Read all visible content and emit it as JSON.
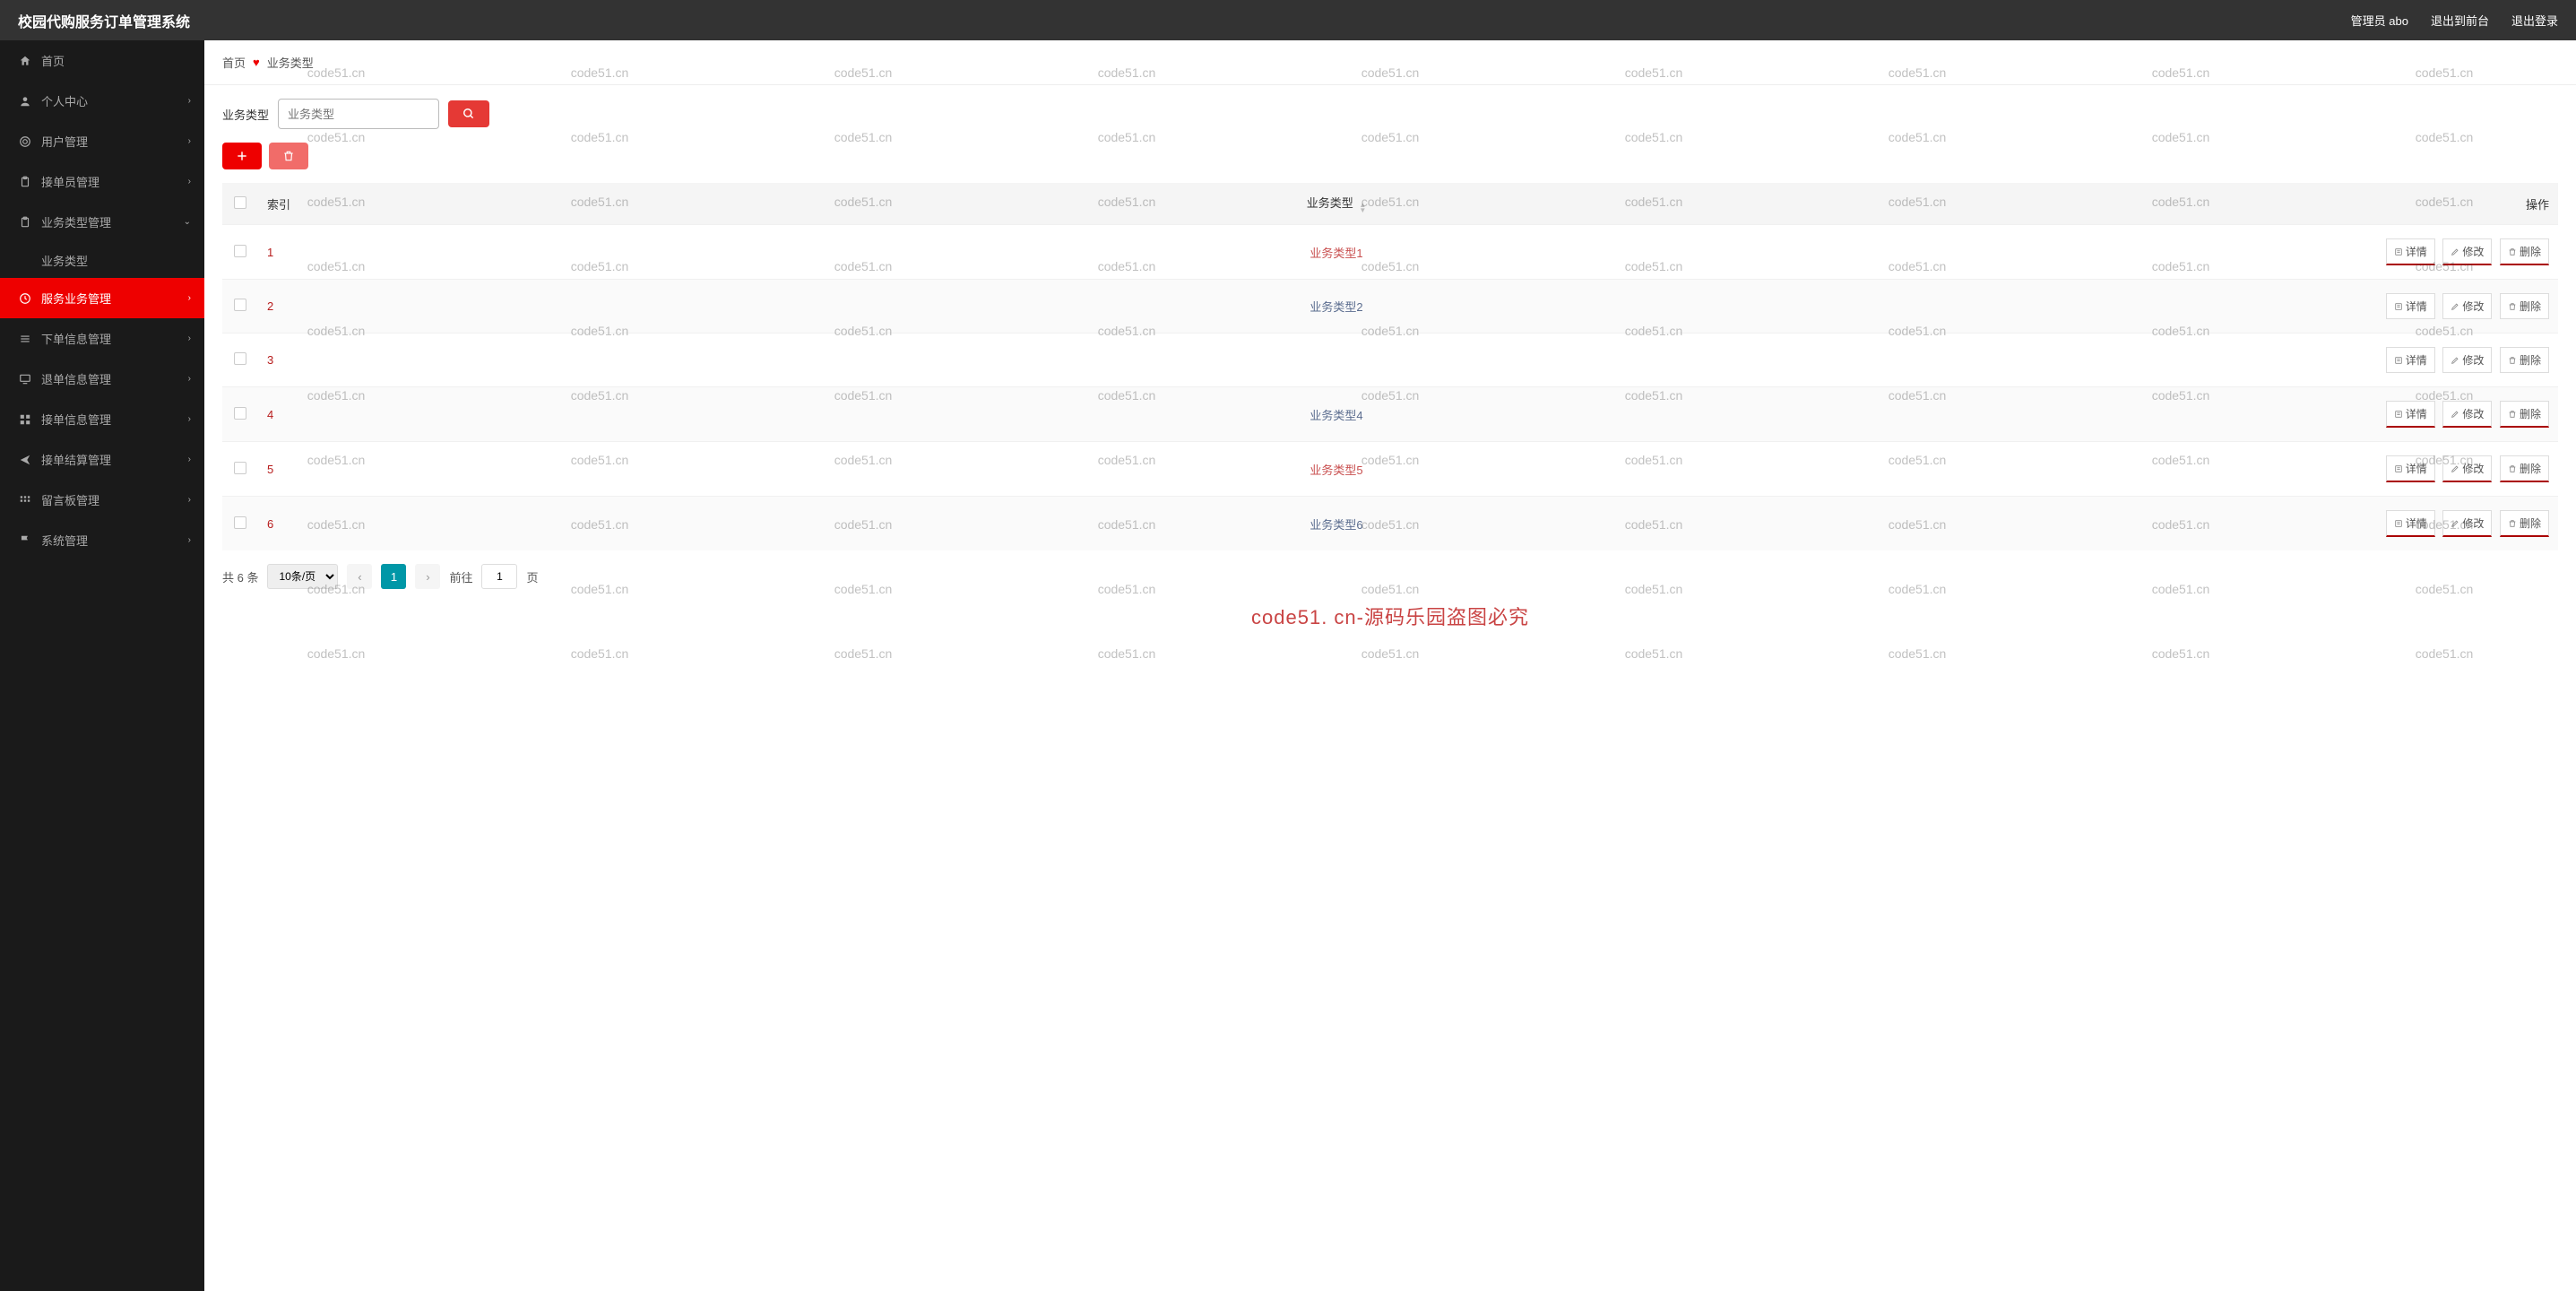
{
  "header": {
    "title": "校园代购服务订单管理系统",
    "admin": "管理员 abo",
    "frontend": "退出到前台",
    "logout": "退出登录"
  },
  "sidebar": {
    "items": [
      {
        "label": "首页",
        "icon": "home",
        "expandable": false
      },
      {
        "label": "个人中心",
        "icon": "user",
        "expandable": true
      },
      {
        "label": "用户管理",
        "icon": "target",
        "expandable": true
      },
      {
        "label": "接单员管理",
        "icon": "clipboard",
        "expandable": true
      },
      {
        "label": "业务类型管理",
        "icon": "clipboard",
        "expandable": true,
        "expanded": true,
        "children": [
          "业务类型"
        ]
      },
      {
        "label": "服务业务管理",
        "icon": "clock",
        "expandable": true,
        "active": true
      },
      {
        "label": "下单信息管理",
        "icon": "list",
        "expandable": true
      },
      {
        "label": "退单信息管理",
        "icon": "monitor",
        "expandable": true
      },
      {
        "label": "接单信息管理",
        "icon": "grid",
        "expandable": true
      },
      {
        "label": "接单结算管理",
        "icon": "send",
        "expandable": true
      },
      {
        "label": "留言板管理",
        "icon": "grid2",
        "expandable": true
      },
      {
        "label": "系统管理",
        "icon": "flag",
        "expandable": true
      }
    ]
  },
  "breadcrumb": {
    "home": "首页",
    "current": "业务类型"
  },
  "search": {
    "label": "业务类型",
    "placeholder": "业务类型"
  },
  "table": {
    "headers": {
      "index": "索引",
      "type": "业务类型",
      "action": "操作"
    },
    "rows": [
      {
        "idx": "1",
        "type": "业务类型1",
        "red": true,
        "underline": true
      },
      {
        "idx": "2",
        "type": "业务类型2",
        "red": false
      },
      {
        "idx": "3",
        "type": "",
        "red": false
      },
      {
        "idx": "4",
        "type": "业务类型4",
        "red": false,
        "underline": true
      },
      {
        "idx": "5",
        "type": "业务类型5",
        "red": true,
        "underline": true
      },
      {
        "idx": "6",
        "type": "业务类型6",
        "red": false,
        "underline": true
      }
    ],
    "actions": {
      "detail": "详情",
      "edit": "修改",
      "delete": "删除"
    }
  },
  "pagination": {
    "total": "共 6 条",
    "pagesize": "10条/页",
    "current": "1",
    "goto_prefix": "前往",
    "goto_suffix": "页",
    "goto_value": "1"
  },
  "watermark": {
    "text": "code51.cn",
    "banner": "code51. cn-源码乐园盗图必究"
  }
}
